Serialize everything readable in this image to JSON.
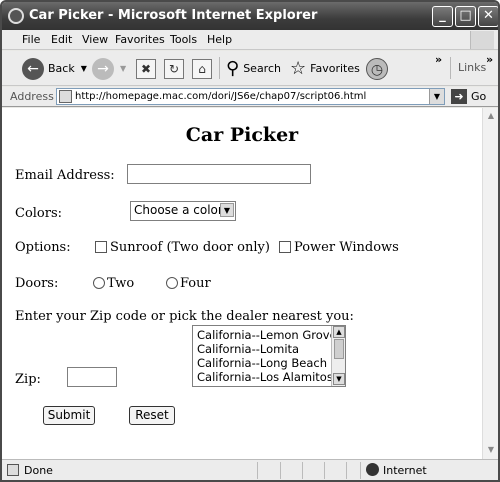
{
  "window": {
    "title": "Car Picker - Microsoft Internet Explorer"
  },
  "menu": [
    "File",
    "Edit",
    "View",
    "Favorites",
    "Tools",
    "Help"
  ],
  "toolbar": {
    "back_label": "Back",
    "search_label": "Search",
    "favorites_label": "Favorites",
    "links_label": "Links"
  },
  "address": {
    "label": "Address",
    "url": "http://homepage.mac.com/dori/JS6e/chap07/script06.html",
    "go_label": "Go"
  },
  "page": {
    "heading": "Car Picker",
    "email_label": "Email Address:",
    "email_value": "",
    "colors_label": "Colors:",
    "colors_selected": "Choose a color",
    "options_label": "Options:",
    "option_sunroof": "Sunroof (Two door only)",
    "option_power_windows": "Power Windows",
    "doors_label": "Doors:",
    "door_two": "Two",
    "door_four": "Four",
    "zip_prompt": "Enter your Zip code or pick the dealer nearest you:",
    "dealers": [
      "California--Lemon Grove",
      "California--Lomita",
      "California--Long Beach",
      "California--Los Alamitos"
    ],
    "zip_label": "Zip:",
    "zip_value": "",
    "submit_label": "Submit",
    "reset_label": "Reset"
  },
  "status": {
    "text": "Done",
    "zone": "Internet"
  }
}
